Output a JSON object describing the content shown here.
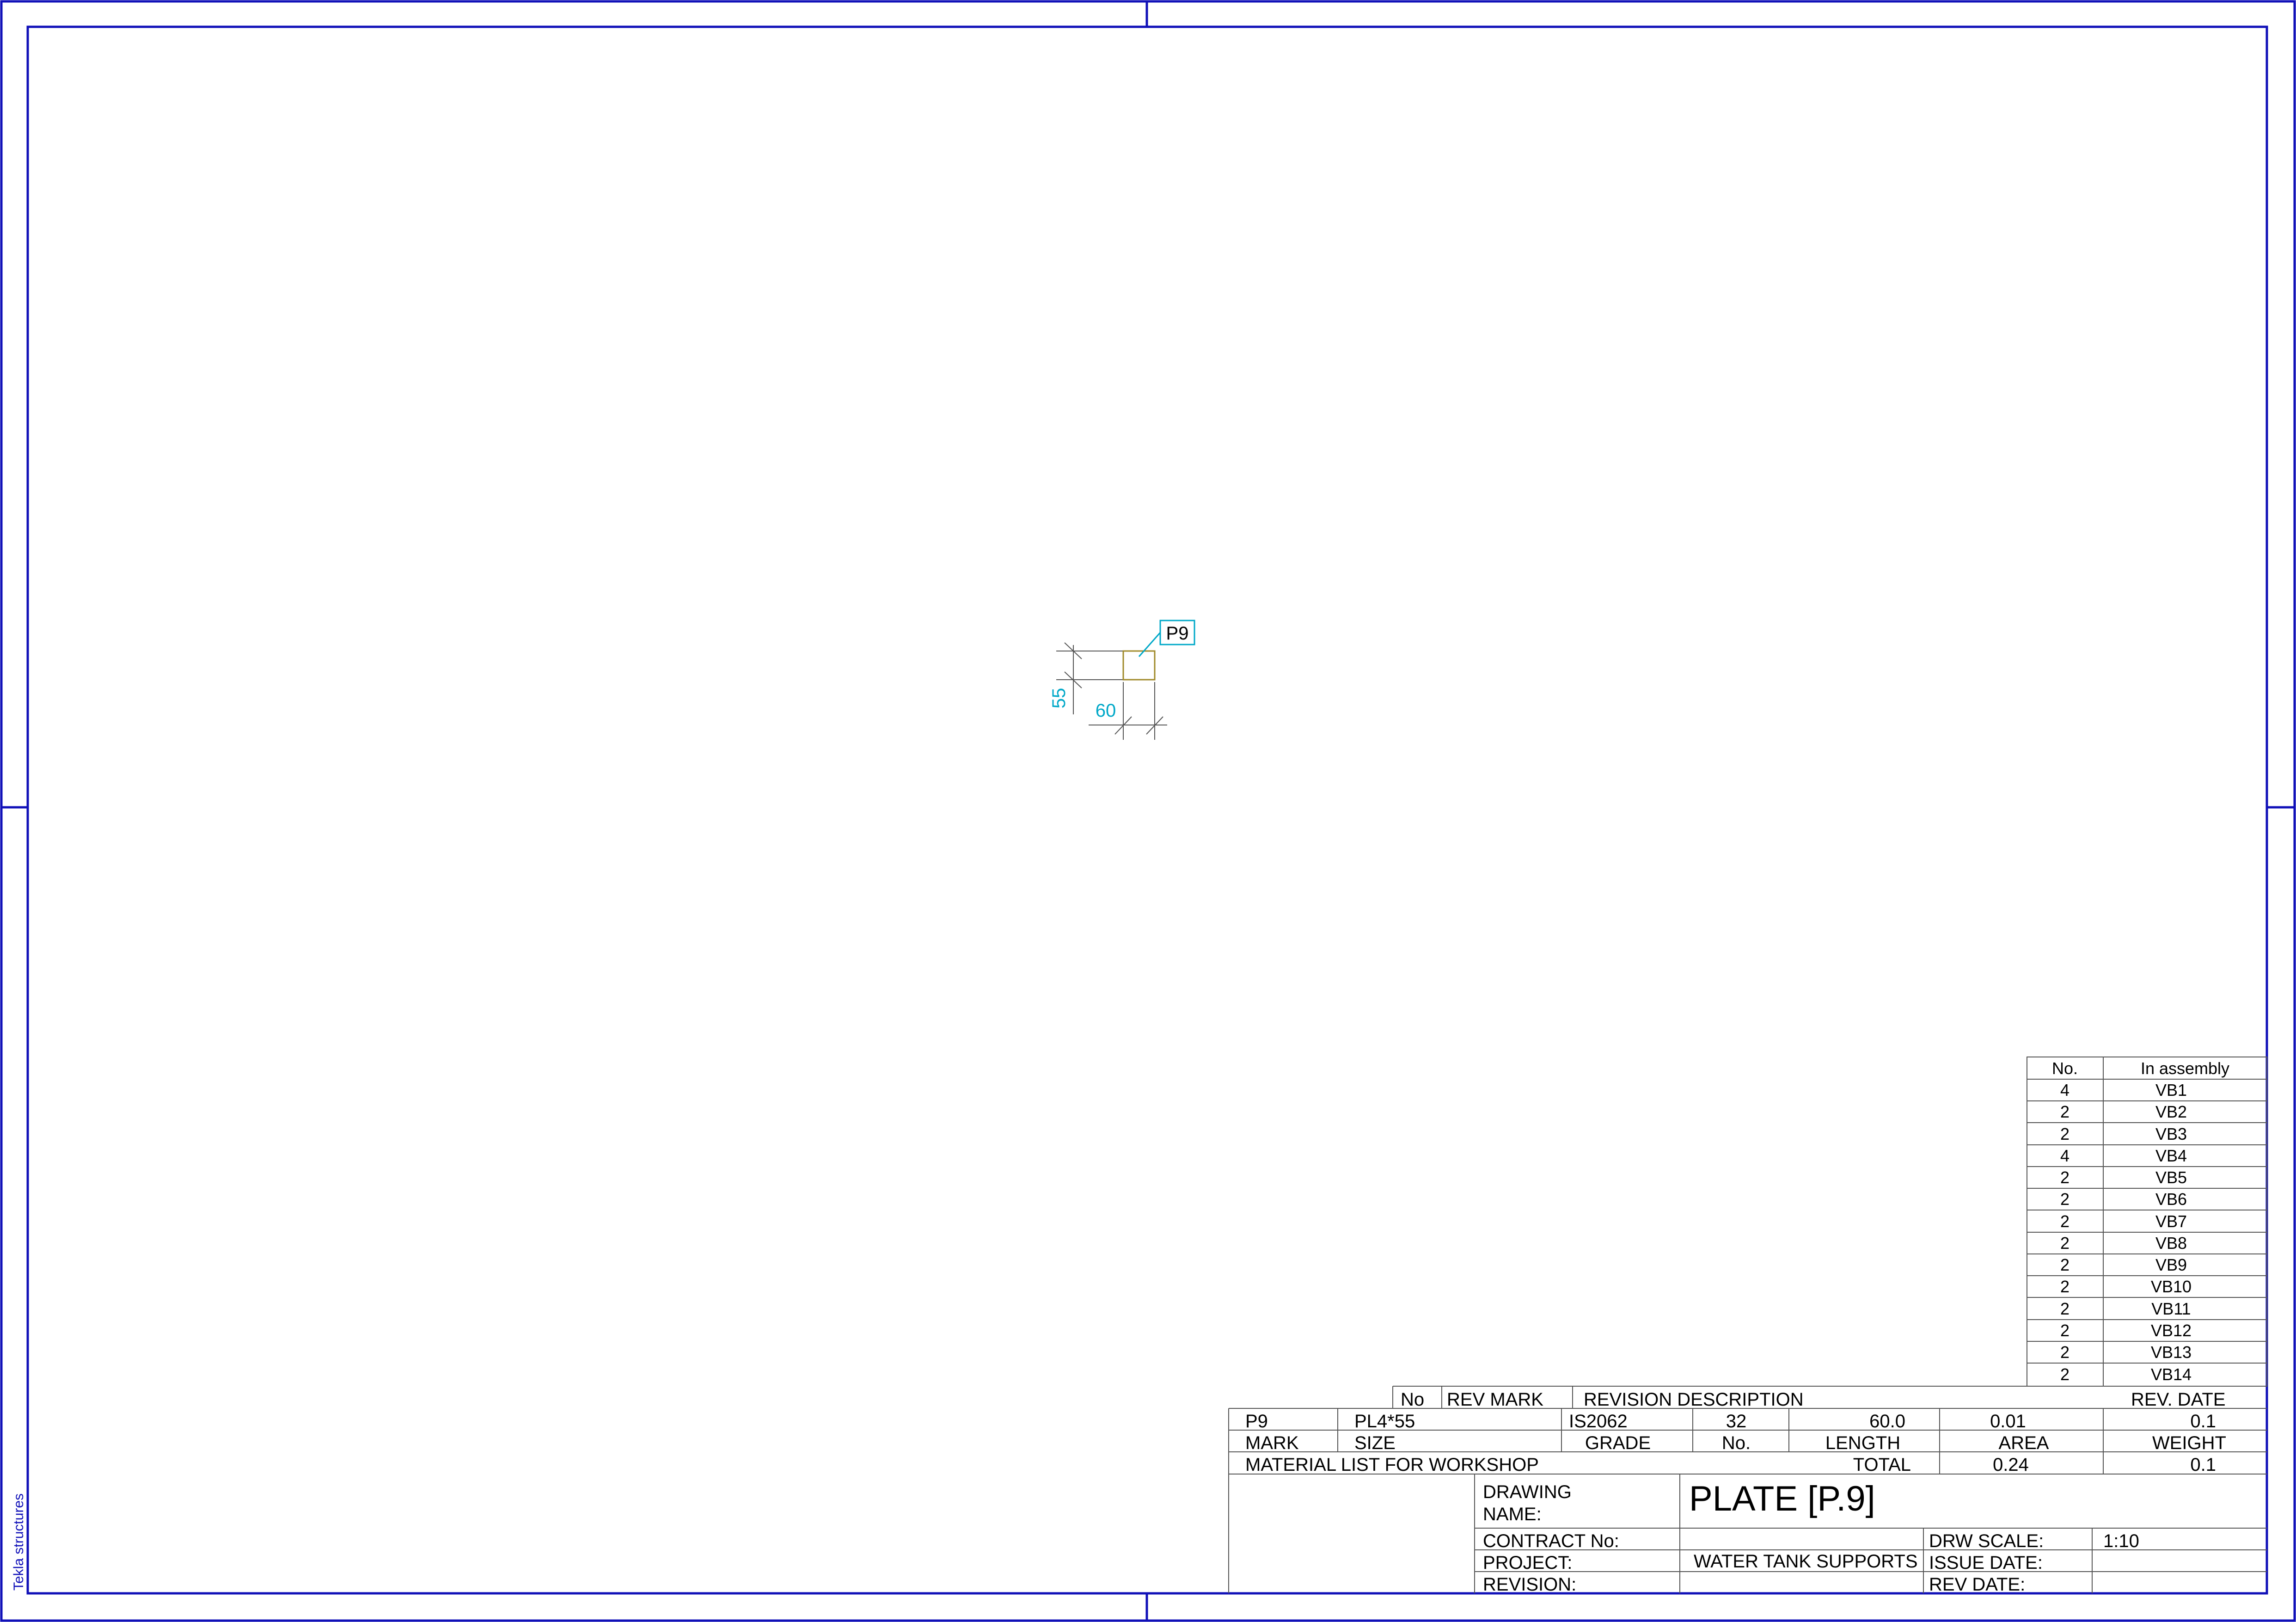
{
  "drawing": {
    "part_mark": "P9",
    "dim_height": "55",
    "dim_width": "60"
  },
  "assembly_table": {
    "headers": [
      "No.",
      "In assembly"
    ],
    "rows": [
      {
        "no": "4",
        "assembly": "VB1"
      },
      {
        "no": "2",
        "assembly": "VB2"
      },
      {
        "no": "2",
        "assembly": "VB3"
      },
      {
        "no": "4",
        "assembly": "VB4"
      },
      {
        "no": "2",
        "assembly": "VB5"
      },
      {
        "no": "2",
        "assembly": "VB6"
      },
      {
        "no": "2",
        "assembly": "VB7"
      },
      {
        "no": "2",
        "assembly": "VB8"
      },
      {
        "no": "2",
        "assembly": "VB9"
      },
      {
        "no": "2",
        "assembly": "VB10"
      },
      {
        "no": "2",
        "assembly": "VB11"
      },
      {
        "no": "2",
        "assembly": "VB12"
      },
      {
        "no": "2",
        "assembly": "VB13"
      },
      {
        "no": "2",
        "assembly": "VB14"
      }
    ]
  },
  "revision_header": {
    "no": "No",
    "rev_mark": "REV MARK",
    "description": "REVISION DESCRIPTION",
    "date": "REV. DATE"
  },
  "material": {
    "row": {
      "mark": "P9",
      "size": "PL4*55",
      "grade": "IS2062",
      "no": "32",
      "length": "60.0",
      "area": "0.01",
      "weight": "0.1"
    },
    "headers": {
      "mark": "MARK",
      "size": "SIZE",
      "grade": "GRADE",
      "no": "No.",
      "length": "LENGTH",
      "area": "AREA",
      "weight": "WEIGHT"
    },
    "list_title": "MATERIAL LIST FOR WORKSHOP",
    "total_label": "TOTAL",
    "total_area": "0.24",
    "total_weight": "0.1"
  },
  "title_block": {
    "drawing_name_label_1": "DRAWING",
    "drawing_name_label_2": "NAME:",
    "drawing_name": "PLATE  [P.9]",
    "contract_label": "CONTRACT No:",
    "contract_value": "",
    "project_label": "PROJECT:",
    "project_value": "WATER TANK SUPPORTS",
    "revision_label": "REVISION:",
    "revision_value": "",
    "scale_label": "DRW SCALE:",
    "scale_value": "1:10",
    "issue_label": "ISSUE DATE:",
    "issue_value": "",
    "revdate_label": "REV DATE:",
    "revdate_value": ""
  },
  "software_label": "Tekla structures",
  "colors": {
    "frame": "#1010b8",
    "dimension": "#00a8c8",
    "part": "#a08a2a",
    "grid": "#555555"
  }
}
